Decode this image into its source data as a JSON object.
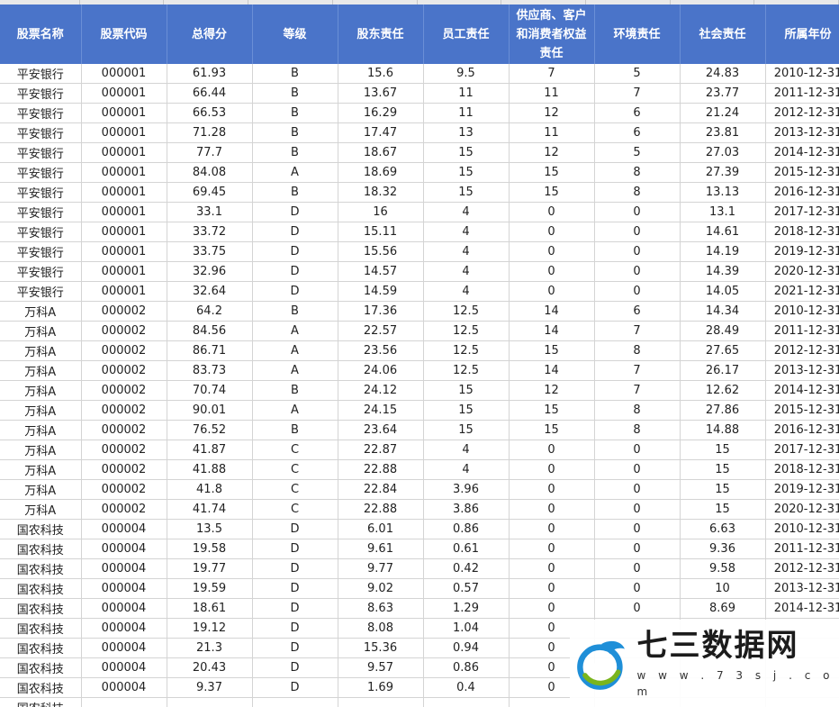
{
  "table": {
    "columns": [
      "股票名称",
      "股票代码",
      "总得分",
      "等级",
      "股东责任",
      "员工责任",
      "供应商、客户和消费者权益责任",
      "环境责任",
      "社会责任",
      "所属年份"
    ],
    "rows": [
      [
        "平安银行",
        "000001",
        "61.93",
        "B",
        "15.6",
        "9.5",
        "7",
        "5",
        "24.83",
        "2010-12-31"
      ],
      [
        "平安银行",
        "000001",
        "66.44",
        "B",
        "13.67",
        "11",
        "11",
        "7",
        "23.77",
        "2011-12-31"
      ],
      [
        "平安银行",
        "000001",
        "66.53",
        "B",
        "16.29",
        "11",
        "12",
        "6",
        "21.24",
        "2012-12-31"
      ],
      [
        "平安银行",
        "000001",
        "71.28",
        "B",
        "17.47",
        "13",
        "11",
        "6",
        "23.81",
        "2013-12-31"
      ],
      [
        "平安银行",
        "000001",
        "77.7",
        "B",
        "18.67",
        "15",
        "12",
        "5",
        "27.03",
        "2014-12-31"
      ],
      [
        "平安银行",
        "000001",
        "84.08",
        "A",
        "18.69",
        "15",
        "15",
        "8",
        "27.39",
        "2015-12-31"
      ],
      [
        "平安银行",
        "000001",
        "69.45",
        "B",
        "18.32",
        "15",
        "15",
        "8",
        "13.13",
        "2016-12-31"
      ],
      [
        "平安银行",
        "000001",
        "33.1",
        "D",
        "16",
        "4",
        "0",
        "0",
        "13.1",
        "2017-12-31"
      ],
      [
        "平安银行",
        "000001",
        "33.72",
        "D",
        "15.11",
        "4",
        "0",
        "0",
        "14.61",
        "2018-12-31"
      ],
      [
        "平安银行",
        "000001",
        "33.75",
        "D",
        "15.56",
        "4",
        "0",
        "0",
        "14.19",
        "2019-12-31"
      ],
      [
        "平安银行",
        "000001",
        "32.96",
        "D",
        "14.57",
        "4",
        "0",
        "0",
        "14.39",
        "2020-12-31"
      ],
      [
        "平安银行",
        "000001",
        "32.64",
        "D",
        "14.59",
        "4",
        "0",
        "0",
        "14.05",
        "2021-12-31"
      ],
      [
        "万科A",
        "000002",
        "64.2",
        "B",
        "17.36",
        "12.5",
        "14",
        "6",
        "14.34",
        "2010-12-31"
      ],
      [
        "万科A",
        "000002",
        "84.56",
        "A",
        "22.57",
        "12.5",
        "14",
        "7",
        "28.49",
        "2011-12-31"
      ],
      [
        "万科A",
        "000002",
        "86.71",
        "A",
        "23.56",
        "12.5",
        "15",
        "8",
        "27.65",
        "2012-12-31"
      ],
      [
        "万科A",
        "000002",
        "83.73",
        "A",
        "24.06",
        "12.5",
        "14",
        "7",
        "26.17",
        "2013-12-31"
      ],
      [
        "万科A",
        "000002",
        "70.74",
        "B",
        "24.12",
        "15",
        "12",
        "7",
        "12.62",
        "2014-12-31"
      ],
      [
        "万科A",
        "000002",
        "90.01",
        "A",
        "24.15",
        "15",
        "15",
        "8",
        "27.86",
        "2015-12-31"
      ],
      [
        "万科A",
        "000002",
        "76.52",
        "B",
        "23.64",
        "15",
        "15",
        "8",
        "14.88",
        "2016-12-31"
      ],
      [
        "万科A",
        "000002",
        "41.87",
        "C",
        "22.87",
        "4",
        "0",
        "0",
        "15",
        "2017-12-31"
      ],
      [
        "万科A",
        "000002",
        "41.88",
        "C",
        "22.88",
        "4",
        "0",
        "0",
        "15",
        "2018-12-31"
      ],
      [
        "万科A",
        "000002",
        "41.8",
        "C",
        "22.84",
        "3.96",
        "0",
        "0",
        "15",
        "2019-12-31"
      ],
      [
        "万科A",
        "000002",
        "41.74",
        "C",
        "22.88",
        "3.86",
        "0",
        "0",
        "15",
        "2020-12-31"
      ],
      [
        "国农科技",
        "000004",
        "13.5",
        "D",
        "6.01",
        "0.86",
        "0",
        "0",
        "6.63",
        "2010-12-31"
      ],
      [
        "国农科技",
        "000004",
        "19.58",
        "D",
        "9.61",
        "0.61",
        "0",
        "0",
        "9.36",
        "2011-12-31"
      ],
      [
        "国农科技",
        "000004",
        "19.77",
        "D",
        "9.77",
        "0.42",
        "0",
        "0",
        "9.58",
        "2012-12-31"
      ],
      [
        "国农科技",
        "000004",
        "19.59",
        "D",
        "9.02",
        "0.57",
        "0",
        "0",
        "10",
        "2013-12-31"
      ],
      [
        "国农科技",
        "000004",
        "18.61",
        "D",
        "8.63",
        "1.29",
        "0",
        "0",
        "8.69",
        "2014-12-31"
      ],
      [
        "国农科技",
        "000004",
        "19.12",
        "D",
        "8.08",
        "1.04",
        "0",
        "",
        "",
        ""
      ],
      [
        "国农科技",
        "000004",
        "21.3",
        "D",
        "15.36",
        "0.94",
        "0",
        "",
        "",
        ""
      ],
      [
        "国农科技",
        "000004",
        "20.43",
        "D",
        "9.57",
        "0.86",
        "0",
        "",
        "",
        ""
      ],
      [
        "国农科技",
        "000004",
        "9.37",
        "D",
        "1.69",
        "0.4",
        "0",
        "",
        "",
        ""
      ],
      [
        "国农科技",
        "",
        "",
        "",
        "",
        "",
        "",
        "",
        "",
        ""
      ]
    ]
  },
  "watermark": {
    "name": "七三数据网",
    "url": "w w w . 7 3 s j . c o m",
    "accent_color": "#1f8fd8",
    "secondary_color": "#7ab51d"
  }
}
